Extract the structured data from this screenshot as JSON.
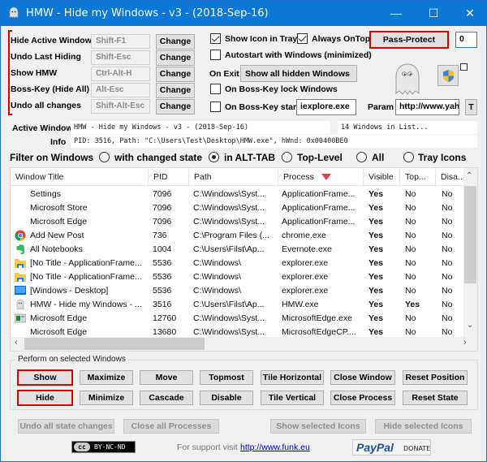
{
  "window": {
    "title": "HMW - Hide my Windows - v3 - (2018-Sep-16)",
    "minimize": "—",
    "maximize": "☐",
    "close": "✕"
  },
  "hotkeys": [
    {
      "label": "Hide Active Window",
      "value": "Shift-F1",
      "button": "Change"
    },
    {
      "label": "Undo Last Hiding",
      "value": "Shift-Esc",
      "button": "Change"
    },
    {
      "label": "Show HMW",
      "value": "Ctrl-Alt-H",
      "button": "Change"
    },
    {
      "label": "Boss-Key (Hide All)",
      "value": "Alt-Esc",
      "button": "Change"
    },
    {
      "label": "Undo all changes",
      "value": "Shift-Alt-Esc",
      "button": "Change"
    }
  ],
  "options": {
    "show_icon_in_tray": {
      "label": "Show Icon in Tray",
      "checked": true
    },
    "always_ontop": {
      "label": "Always OnTop",
      "checked": true
    },
    "autostart": {
      "label": "Autostart with Windows (minimized)",
      "checked": false
    },
    "on_exit_label": "On Exit",
    "on_exit_value": "Show all hidden Windows",
    "boss_lock": {
      "label": "On Boss-Key lock Windows",
      "checked": false
    },
    "boss_start": {
      "label": "On Boss-Key start",
      "checked": false
    },
    "boss_start_value": "iexplore.exe",
    "param_label": "Param",
    "param_value": "http://www.yahc",
    "t_button": "T",
    "pass_protect": "Pass-Protect",
    "pass_count": "0"
  },
  "active_window": {
    "label": "Active Window",
    "value": "HMW - Hide my Windows - v3 - (2018-Sep-16)",
    "count": "14 Windows in List...",
    "info_label": "Info",
    "info_value": "PID: 3516, Path: \"C:\\Users\\Test\\Desktop\\HMW.exe\", hWnd: 0x00400BE0"
  },
  "filter": {
    "label": "Filter on Windows",
    "options": [
      {
        "label": "with changed state",
        "selected": false
      },
      {
        "label": "in ALT-TAB",
        "selected": true
      },
      {
        "label": "Top-Level",
        "selected": false
      },
      {
        "label": "All",
        "selected": false
      },
      {
        "label": "Tray Icons",
        "selected": false
      }
    ]
  },
  "table": {
    "columns": [
      "Window Title",
      "PID",
      "Path",
      "Process",
      "Visible",
      "Top...",
      "Disa..."
    ],
    "sort_column": "Process",
    "rows": [
      {
        "icon": "none",
        "title": "Settings",
        "pid": "7096",
        "path": "C:\\Windows\\Syst...",
        "process": "ApplicationFrame...",
        "visible": "Yes",
        "top": "No",
        "disabled": "No"
      },
      {
        "icon": "none",
        "title": "Microsoft Store",
        "pid": "7096",
        "path": "C:\\Windows\\Syst...",
        "process": "ApplicationFrame...",
        "visible": "Yes",
        "top": "No",
        "disabled": "No"
      },
      {
        "icon": "none",
        "title": "Microsoft Edge",
        "pid": "7096",
        "path": "C:\\Windows\\Syst...",
        "process": "ApplicationFrame...",
        "visible": "Yes",
        "top": "No",
        "disabled": "No"
      },
      {
        "icon": "chrome",
        "title": "Add New Post",
        "pid": "736",
        "path": "C:\\Program Files (...",
        "process": "chrome.exe",
        "visible": "Yes",
        "top": "No",
        "disabled": "No"
      },
      {
        "icon": "evernote",
        "title": "All Notebooks",
        "pid": "1004",
        "path": "C:\\Users\\Filst\\Ap...",
        "process": "Evernote.exe",
        "visible": "Yes",
        "top": "No",
        "disabled": "No"
      },
      {
        "icon": "folder",
        "title": "[No Title - ApplicationFrame...",
        "pid": "5536",
        "path": "C:\\Windows\\",
        "process": "explorer.exe",
        "visible": "Yes",
        "top": "No",
        "disabled": "No"
      },
      {
        "icon": "folder",
        "title": "[No Title - ApplicationFrame...",
        "pid": "5536",
        "path": "C:\\Windows\\",
        "process": "explorer.exe",
        "visible": "Yes",
        "top": "No",
        "disabled": "No"
      },
      {
        "icon": "desktop",
        "title": "[Windows - Desktop]",
        "pid": "5536",
        "path": "C:\\Windows\\",
        "process": "explorer.exe",
        "visible": "Yes",
        "top": "No",
        "disabled": "No"
      },
      {
        "icon": "ghost",
        "title": "HMW - Hide my Windows - ...",
        "pid": "3516",
        "path": "C:\\Users\\Filst\\Ap...",
        "process": "HMW.exe",
        "visible": "Yes",
        "top": "Yes",
        "disabled": "No"
      },
      {
        "icon": "edge",
        "title": "Microsoft Edge",
        "pid": "12760",
        "path": "C:\\Windows\\Syst...",
        "process": "MicrosoftEdge.exe",
        "visible": "Yes",
        "top": "No",
        "disabled": "No"
      },
      {
        "icon": "none",
        "title": "Microsoft Edge",
        "pid": "13680",
        "path": "C:\\Windows\\Syst...",
        "process": "MicrosoftEdgeCP....",
        "visible": "Yes",
        "top": "No",
        "disabled": "No"
      }
    ]
  },
  "perform": {
    "label": "Perform on selected Windows",
    "row1": [
      "Show",
      "Maximize",
      "Move",
      "Topmost",
      "Tile Horizontal",
      "Close Window",
      "Reset Position"
    ],
    "row2": [
      "Hide",
      "Minimize",
      "Cascade",
      "Disable",
      "Tile Vertical",
      "Close Process",
      "Reset State"
    ]
  },
  "bottom": {
    "undo_all": "Undo all state changes",
    "close_all": "Close all Processes",
    "show_icons": "Show selected Icons",
    "hide_icons": "Hide selected Icons",
    "license": "BY-NC-ND",
    "cc": "cc",
    "support_text": "For support visit",
    "support_link": "http://www.funk.eu",
    "paypal": "PayPal",
    "donate": "DONATE"
  },
  "colors": {
    "titlebar": "#0b78d7",
    "highlight": "#e00000"
  }
}
